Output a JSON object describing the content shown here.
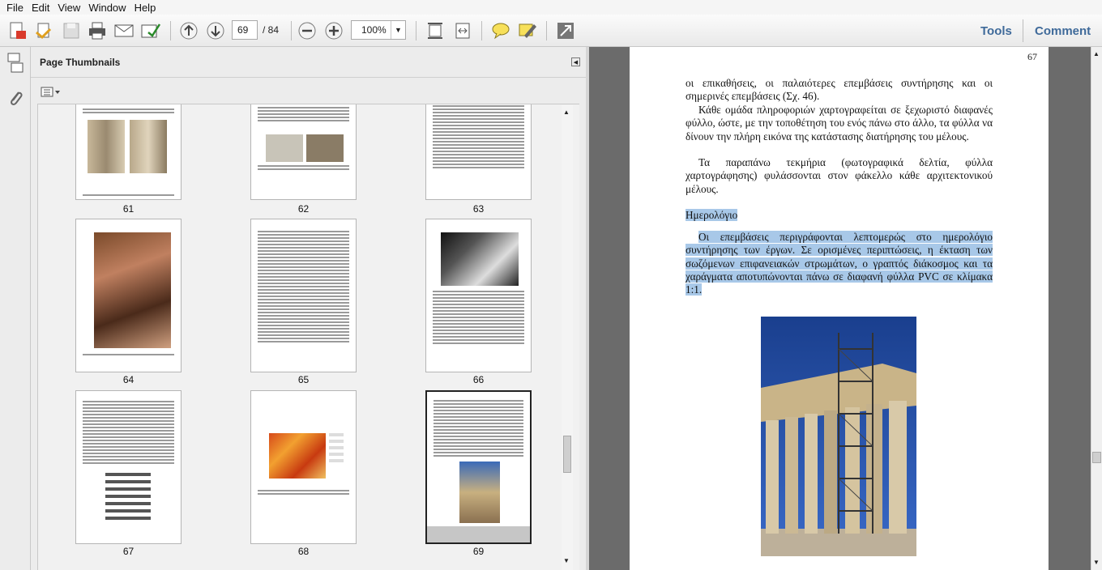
{
  "menu": [
    "File",
    "Edit",
    "View",
    "Window",
    "Help"
  ],
  "toolbar": {
    "page_current": "69",
    "page_total": "/ 84",
    "zoom": "100%",
    "tools": "Tools",
    "comment": "Comment"
  },
  "panel": {
    "title": "Page Thumbnails"
  },
  "thumbs": [
    {
      "label": "61"
    },
    {
      "label": "62"
    },
    {
      "label": "63"
    },
    {
      "label": "64"
    },
    {
      "label": "65"
    },
    {
      "label": "66"
    },
    {
      "label": "67"
    },
    {
      "label": "68"
    },
    {
      "label": "69"
    }
  ],
  "doc": {
    "page_number": "67",
    "p1": "οι επικαθήσεις, οι παλαιότερες επεμβάσεις συντήρησης και οι σημερινές επεμβάσεις (Σχ. 46).",
    "p2": "Κάθε ομάδα πληροφοριών χαρτογραφείται σε ξεχωριστό διαφανές φύλλο, ώστε, με την τοποθέτηση του ενός πάνω στο άλλο, τα φύλλα να δίνουν την πλήρη εικόνα της κατάστασης διατήρησης του μέλους.",
    "p3": "Τα παραπάνω τεκμήρια (φωτογραφικά δελτία, φύλλα χαρτογράφησης) φυλάσσονται στον φάκελλο κάθε αρχιτεκτονικού μέλους.",
    "heading": "Ημερολόγιο",
    "p4": "Οι επεμβάσεις περιγράφονται λεπτομερώς στο ημερολόγιο συντήρησης των έργων. Σε ορισμένες περιπτώσεις, η έκταση των σωζόμενων επιφανειακών στρωμάτων, ο γραπτός διάκοσμος και τα χαράγματα αποτυπώνονται πάνω σε διαφανή φύλλα PVC σε κλίμακα 1:1."
  },
  "icons": [
    "create-pdf-icon",
    "open-icon",
    "save-icon",
    "print-icon",
    "email-icon",
    "form-icon",
    "prev-page-icon",
    "next-page-icon",
    "zoom-out-icon",
    "zoom-in-icon",
    "fit-page-icon",
    "fit-width-icon",
    "comment-icon",
    "highlight-icon",
    "fullscreen-icon"
  ]
}
